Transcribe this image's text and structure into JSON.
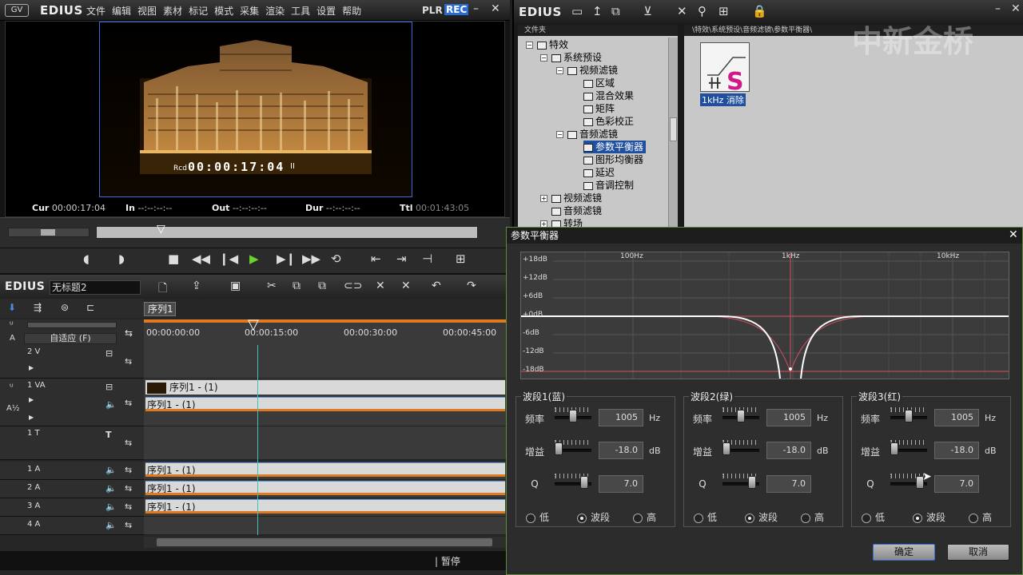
{
  "player": {
    "logo": "EDIUS",
    "menu": [
      "文件",
      "编辑",
      "视图",
      "素材",
      "标记",
      "模式",
      "采集",
      "渲染",
      "工具",
      "设置",
      "帮助"
    ],
    "mode_plr": "PLR",
    "mode_rec": "REC",
    "rec_label": "Rcd",
    "rec_timecode": "00:00:17:04",
    "cur_label": "Cur",
    "cur_value": "00:00:17:04",
    "in_label": "In",
    "in_value": "--:--:--:--",
    "out_label": "Out",
    "out_value": "--:--:--:--",
    "dur_label": "Dur",
    "dur_value": "--:--:--:--",
    "ttl_label": "Ttl",
    "ttl_value": "00:01:43:05"
  },
  "timeline": {
    "logo": "EDIUS",
    "project": "无标题2",
    "seq_tab": "序列1",
    "fit_label": "自适应 (F)",
    "ruler": [
      "00:00:00:00",
      "00:00:15:00",
      "00:00:30:00",
      "00:00:45:00"
    ],
    "tracks": [
      {
        "name": "2 V",
        "clip": ""
      },
      {
        "name": "1 VA",
        "clip": "序列1 - (1)",
        "audio_clip": "序列1 - (1)"
      },
      {
        "name": "1 T",
        "clip": ""
      },
      {
        "name": "1 A",
        "clip": "序列1 - (1)"
      },
      {
        "name": "2 A",
        "clip": "序列1 - (1)"
      },
      {
        "name": "3 A",
        "clip": "序列1 - (1)"
      },
      {
        "name": "4 A",
        "clip": ""
      }
    ],
    "status": "暂停"
  },
  "bin": {
    "logo": "EDIUS",
    "tree_header": "文件夹",
    "path": "\\特效\\系统预设\\音频滤镜\\参数平衡器\\",
    "watermark": "中新金桥",
    "tree": [
      {
        "label": "特效"
      },
      {
        "label": "系统预设"
      },
      {
        "label": "视频滤镜"
      },
      {
        "label": "区域"
      },
      {
        "label": "混合效果"
      },
      {
        "label": "矩阵"
      },
      {
        "label": "色彩校正"
      },
      {
        "label": "音频滤镜"
      },
      {
        "label": "参数平衡器"
      },
      {
        "label": "图形均衡器"
      },
      {
        "label": "延迟"
      },
      {
        "label": "音调控制"
      },
      {
        "label": "视频滤镜"
      },
      {
        "label": "音频滤镜"
      },
      {
        "label": "转场"
      }
    ],
    "preset_label": "1kHz 消除"
  },
  "dialog": {
    "title": "参数平衡器",
    "db_labels": [
      "+18dB",
      "+12dB",
      "+6dB",
      "+0dB",
      "-6dB",
      "-12dB",
      "-18dB"
    ],
    "freq_labels": [
      "100Hz",
      "1kHz",
      "10kHz"
    ],
    "bands": [
      {
        "title": "波段1(蓝)",
        "freq": "1005",
        "gain": "-18.0",
        "q": "7.0",
        "freq_pos": 0.5,
        "gain_pos": 0.0,
        "q_pos": 0.9
      },
      {
        "title": "波段2(绿)",
        "freq": "1005",
        "gain": "-18.0",
        "q": "7.0",
        "freq_pos": 0.5,
        "gain_pos": 0.0,
        "q_pos": 0.9
      },
      {
        "title": "波段3(红)",
        "freq": "1005",
        "gain": "-18.0",
        "q": "7.0",
        "freq_pos": 0.5,
        "gain_pos": 0.0,
        "q_pos": 0.9
      }
    ],
    "freq_label": "频率",
    "gain_label": "增益",
    "q_label": "Q",
    "hz_unit": "Hz",
    "db_unit": "dB",
    "radio_low": "低",
    "radio_band": "波段",
    "radio_high": "高",
    "ok": "确定",
    "cancel": "取消"
  }
}
